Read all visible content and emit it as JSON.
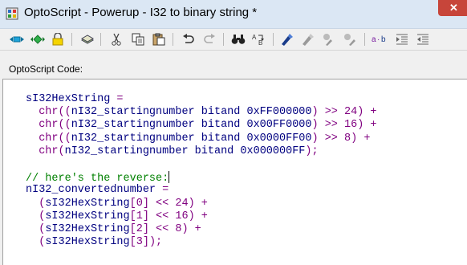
{
  "window": {
    "title": "OptoScript - Powerup - I32 to binary string *"
  },
  "toolbar": {
    "buttons": [
      {
        "name": "step-into-icon"
      },
      {
        "name": "step-over-icon"
      },
      {
        "name": "lock-icon"
      },
      {
        "name": "compile-icon"
      },
      {
        "name": "cut-icon"
      },
      {
        "name": "copy-icon"
      },
      {
        "name": "paste-icon"
      },
      {
        "name": "undo-icon"
      },
      {
        "name": "redo-icon"
      },
      {
        "name": "find-icon"
      },
      {
        "name": "replace-icon"
      },
      {
        "name": "insert-variable-icon"
      },
      {
        "name": "insert-command-icon"
      },
      {
        "name": "insert-condition-icon"
      },
      {
        "name": "insert-action-icon"
      },
      {
        "name": "variable-case-icon"
      },
      {
        "name": "indent-icon"
      },
      {
        "name": "outdent-icon"
      }
    ]
  },
  "editor": {
    "label": "OptoScript Code:",
    "lines": [
      [
        {
          "t": "ident",
          "v": "sI32HexString"
        },
        {
          "t": "op",
          "v": " ="
        }
      ],
      [
        {
          "t": "plain",
          "v": "  "
        },
        {
          "t": "func",
          "v": "chr"
        },
        {
          "t": "op",
          "v": "(("
        },
        {
          "t": "ident",
          "v": "nI32_startingnumber"
        },
        {
          "t": "plain",
          "v": " "
        },
        {
          "t": "kw",
          "v": "bitand"
        },
        {
          "t": "plain",
          "v": " "
        },
        {
          "t": "hex",
          "v": "0xFF000000"
        },
        {
          "t": "op",
          "v": ") >> "
        },
        {
          "t": "num",
          "v": "24"
        },
        {
          "t": "op",
          "v": ") +"
        }
      ],
      [
        {
          "t": "plain",
          "v": "  "
        },
        {
          "t": "func",
          "v": "chr"
        },
        {
          "t": "op",
          "v": "(("
        },
        {
          "t": "ident",
          "v": "nI32_startingnumber"
        },
        {
          "t": "plain",
          "v": " "
        },
        {
          "t": "kw",
          "v": "bitand"
        },
        {
          "t": "plain",
          "v": " "
        },
        {
          "t": "hex",
          "v": "0x00FF0000"
        },
        {
          "t": "op",
          "v": ") >> "
        },
        {
          "t": "num",
          "v": "16"
        },
        {
          "t": "op",
          "v": ") +"
        }
      ],
      [
        {
          "t": "plain",
          "v": "  "
        },
        {
          "t": "func",
          "v": "chr"
        },
        {
          "t": "op",
          "v": "(("
        },
        {
          "t": "ident",
          "v": "nI32_startingnumber"
        },
        {
          "t": "plain",
          "v": " "
        },
        {
          "t": "kw",
          "v": "bitand"
        },
        {
          "t": "plain",
          "v": " "
        },
        {
          "t": "hex",
          "v": "0x0000FF00"
        },
        {
          "t": "op",
          "v": ") >> "
        },
        {
          "t": "num",
          "v": "8"
        },
        {
          "t": "op",
          "v": ") +"
        }
      ],
      [
        {
          "t": "plain",
          "v": "  "
        },
        {
          "t": "func",
          "v": "chr"
        },
        {
          "t": "op",
          "v": "("
        },
        {
          "t": "ident",
          "v": "nI32_startingnumber"
        },
        {
          "t": "plain",
          "v": " "
        },
        {
          "t": "kw",
          "v": "bitand"
        },
        {
          "t": "plain",
          "v": " "
        },
        {
          "t": "hex",
          "v": "0x000000FF"
        },
        {
          "t": "op",
          "v": ");"
        }
      ],
      [],
      [
        {
          "t": "comment",
          "v": "// here's the reverse:"
        },
        {
          "t": "caret",
          "v": ""
        }
      ],
      [
        {
          "t": "ident",
          "v": "nI32_convertednumber"
        },
        {
          "t": "op",
          "v": " ="
        }
      ],
      [
        {
          "t": "plain",
          "v": "  "
        },
        {
          "t": "op",
          "v": "("
        },
        {
          "t": "ident",
          "v": "sI32HexString"
        },
        {
          "t": "op",
          "v": "["
        },
        {
          "t": "num",
          "v": "0"
        },
        {
          "t": "op",
          "v": "] << "
        },
        {
          "t": "num",
          "v": "24"
        },
        {
          "t": "op",
          "v": ") +"
        }
      ],
      [
        {
          "t": "plain",
          "v": "  "
        },
        {
          "t": "op",
          "v": "("
        },
        {
          "t": "ident",
          "v": "sI32HexString"
        },
        {
          "t": "op",
          "v": "["
        },
        {
          "t": "num",
          "v": "1"
        },
        {
          "t": "op",
          "v": "] << "
        },
        {
          "t": "num",
          "v": "16"
        },
        {
          "t": "op",
          "v": ") +"
        }
      ],
      [
        {
          "t": "plain",
          "v": "  "
        },
        {
          "t": "op",
          "v": "("
        },
        {
          "t": "ident",
          "v": "sI32HexString"
        },
        {
          "t": "op",
          "v": "["
        },
        {
          "t": "num",
          "v": "2"
        },
        {
          "t": "op",
          "v": "] << "
        },
        {
          "t": "num",
          "v": "8"
        },
        {
          "t": "op",
          "v": ") +"
        }
      ],
      [
        {
          "t": "plain",
          "v": "  "
        },
        {
          "t": "op",
          "v": "("
        },
        {
          "t": "ident",
          "v": "sI32HexString"
        },
        {
          "t": "op",
          "v": "["
        },
        {
          "t": "num",
          "v": "3"
        },
        {
          "t": "op",
          "v": "]);"
        }
      ]
    ]
  }
}
